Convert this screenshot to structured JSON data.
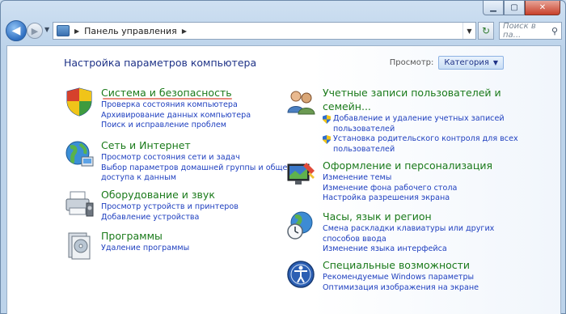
{
  "breadcrumb": {
    "root": "Панель управления"
  },
  "search": {
    "placeholder": "Поиск в па..."
  },
  "page": {
    "title": "Настройка параметров компьютера"
  },
  "view": {
    "label": "Просмотр:",
    "value": "Категория"
  },
  "categories_left": [
    {
      "title": "Система и безопасность",
      "icon": "shield-icon",
      "links": [
        "Проверка состояния компьютера",
        "Архивирование данных компьютера",
        "Поиск и исправление проблем"
      ]
    },
    {
      "title": "Сеть и Интернет",
      "icon": "globe-network-icon",
      "links": [
        "Просмотр состояния сети и задач",
        "Выбор параметров домашней группы и общего",
        "доступа к данным"
      ]
    },
    {
      "title": "Оборудование и звук",
      "icon": "printer-icon",
      "links": [
        "Просмотр устройств и принтеров",
        "Добавление устройства"
      ]
    },
    {
      "title": "Программы",
      "icon": "programs-icon",
      "links": [
        "Удаление программы"
      ]
    }
  ],
  "categories_right": [
    {
      "title": "Учетные записи пользователей и",
      "title2": "семейн...",
      "icon": "users-icon",
      "links": [
        "Добавление и удаление учетных записей",
        "пользователей",
        "Установка родительского контроля для всех",
        "пользователей"
      ]
    },
    {
      "title": "Оформление и персонализация",
      "icon": "monitor-paint-icon",
      "links": [
        "Изменение темы",
        "Изменение фона рабочего стола",
        "Настройка разрешения экрана"
      ]
    },
    {
      "title": "Часы, язык и регион",
      "icon": "clock-globe-icon",
      "links": [
        "Смена раскладки клавиатуры или других",
        "способов ввода",
        "Изменение языка интерфейса"
      ]
    },
    {
      "title": "Специальные возможности",
      "icon": "accessibility-icon",
      "links": [
        "Рекомендуемые Windows параметры",
        "Оптимизация изображения на экране"
      ]
    }
  ]
}
